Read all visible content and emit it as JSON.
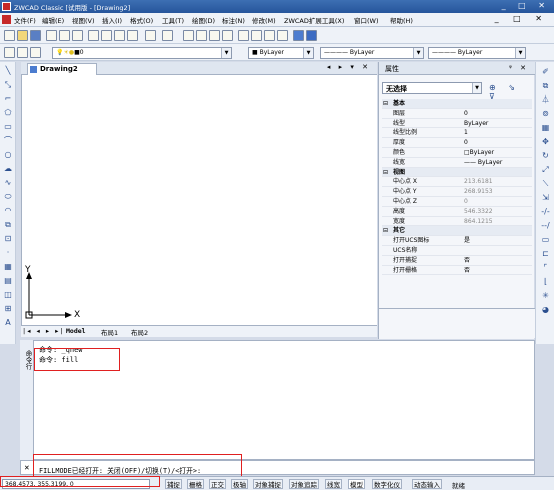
{
  "window": {
    "title": "ZWCAD Classic [试用版 - [Drawing2]"
  },
  "menu": [
    "文件(F)",
    "编辑(E)",
    "视图(V)",
    "插入(I)",
    "格式(O)",
    "工具(T)",
    "绘图(D)",
    "标注(N)",
    "修改(M)",
    "ZWCAD扩展工具(X)",
    "窗口(W)",
    "帮助(H)"
  ],
  "toolbar2": {
    "layer": "0",
    "color": "ByLayer",
    "linetype": "ByLayer",
    "lineweight": "ByLayer"
  },
  "doc_tab": {
    "label": "Drawing2"
  },
  "canvas": {
    "y_axis": "Y",
    "x_axis": "X"
  },
  "layout_tabs": [
    "Model",
    "布局1",
    "布局2"
  ],
  "properties": {
    "header": "属性",
    "selection": "无选择",
    "rows": [
      {
        "k": "基本",
        "cat": true
      },
      {
        "k": "图层",
        "v": "0"
      },
      {
        "k": "线型",
        "v": "ByLayer"
      },
      {
        "k": "线型比例",
        "v": "1"
      },
      {
        "k": "厚度",
        "v": "0"
      },
      {
        "k": "颜色",
        "v": "□ByLayer"
      },
      {
        "k": "线宽",
        "v": "—— ByLayer"
      },
      {
        "k": "视图",
        "cat": true
      },
      {
        "k": "中心点 X",
        "v": "213.6181",
        "dim": true
      },
      {
        "k": "中心点 Y",
        "v": "268.9153",
        "dim": true
      },
      {
        "k": "中心点 Z",
        "v": "0",
        "dim": true
      },
      {
        "k": "高度",
        "v": "546.3322",
        "dim": true
      },
      {
        "k": "宽度",
        "v": "864.1215",
        "dim": true
      },
      {
        "k": "其它",
        "cat": true
      },
      {
        "k": "打开UCS图标",
        "v": "是"
      },
      {
        "k": "UCS名称",
        "v": ""
      },
      {
        "k": "打开捕捉",
        "v": "否"
      },
      {
        "k": "打开栅格",
        "v": "否"
      }
    ]
  },
  "command": {
    "side_label": "命令行",
    "lines": [
      "命令: _qnew",
      "命令: fill"
    ],
    "prompt": "FILLMODE已经打开:  关闭(OFF)/切换(T)/<打开>:"
  },
  "status": {
    "coords": "368.4573,  355.3199,  0",
    "buttons": [
      "捕捉",
      "栅格",
      "正交",
      "极轴",
      "对象捕捉",
      "对象追踪",
      "线宽",
      "模型",
      "数字化仪",
      "动态输入",
      "就绪"
    ]
  }
}
